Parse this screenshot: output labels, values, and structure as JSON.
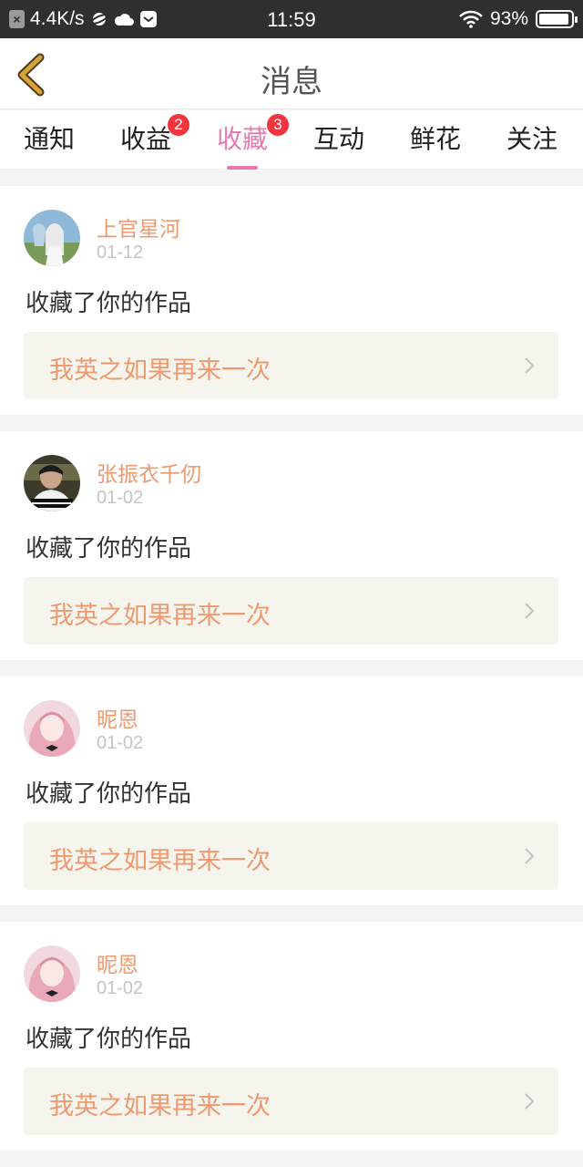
{
  "status_bar": {
    "network_speed": "4.4K/s",
    "time": "11:59",
    "battery": "93%",
    "battery_level": 0.93
  },
  "header": {
    "title": "消息"
  },
  "tabs": [
    {
      "label": "通知"
    },
    {
      "label": "收益",
      "badge": "2"
    },
    {
      "label": "收藏",
      "badge": "3",
      "active": true
    },
    {
      "label": "互动"
    },
    {
      "label": "鲜花"
    },
    {
      "label": "关注"
    }
  ],
  "messages": [
    {
      "user": "上官星河",
      "date": "01-12",
      "action": "收藏了你的作品",
      "work": "我英之如果再来一次"
    },
    {
      "user": "张振衣千仞",
      "date": "01-02",
      "action": "收藏了你的作品",
      "work": "我英之如果再来一次"
    },
    {
      "user": "昵恩",
      "date": "01-02",
      "action": "收藏了你的作品",
      "work": "我英之如果再来一次"
    },
    {
      "user": "昵恩",
      "date": "01-02",
      "action": "收藏了你的作品",
      "work": "我英之如果再来一次"
    }
  ],
  "colors": {
    "accent": "#e87ab0",
    "name": "#ee9a70",
    "badge": "#f0353f",
    "back_arrow": "#d8a334"
  }
}
